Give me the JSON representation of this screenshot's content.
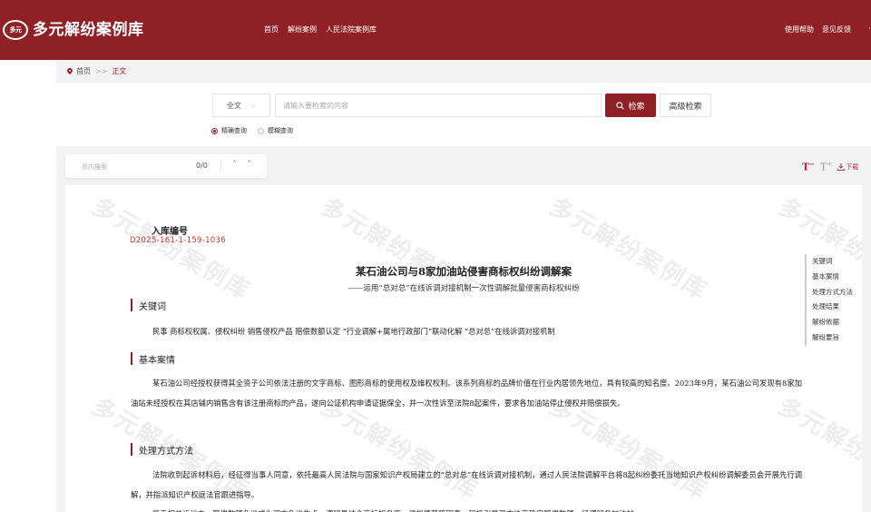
{
  "header": {
    "logo_text": "多元",
    "site_title": "多元解纷案例库",
    "nav": [
      "首页",
      "解纷案例",
      "人民法院案例库"
    ],
    "right_links": [
      "使用帮助",
      "意见反馈"
    ],
    "more": "·"
  },
  "breadcrumb": {
    "home": "首页",
    "sep": ">>",
    "current": "正文"
  },
  "search": {
    "scope": "全文",
    "placeholder": "请输入要检索的内容",
    "search_button": "检索",
    "advanced_button": "高级检索",
    "modes": [
      {
        "label": "精确查询",
        "selected": true
      },
      {
        "label": "模糊查询",
        "selected": false
      }
    ]
  },
  "find": {
    "placeholder": "页内搜索",
    "count": "0/0"
  },
  "tools": {
    "font_decrease": "T",
    "font_increase": "T",
    "download": "下载"
  },
  "document": {
    "reg_label": "入库编号",
    "reg_no": "D2025-161-1-159-1036",
    "title": "某石油公司与8家加油站侵害商标权纠纷调解案",
    "subtitle": "——运用“总对总”在线诉调对接机制一次性调解批量侵害商标权纠纷",
    "watermark": "多元解纷案例库",
    "sections": {
      "keywords_head": "关键词",
      "keywords_text": "民事  商标权权属、侵权纠纷  销售侵权产品  赔偿数额认定  “行业调解+属地行政部门”联动化解  “总对总”在线诉调对接机制",
      "facts_head": "基本案情",
      "facts_text": "某石油公司经授权获得其全资子公司依法注册的文字商标、图形商标的使用权及维权权利。该系列商标的品牌价值在行业内居领先地位，具有较高的知名度。2023年9月，某石油公司发现有8家加油站未经授权在其店铺内销售含有该注册商标的产品，遂向公证机构申请证据保全，并一次性诉至法院8起案件，要求各加油站停止侵权并赔偿损失。",
      "method_head": "处理方式方法",
      "method_text": "法院收到起诉材料后，经征得当事人同意，依托最高人民法院与国家知识产权局建立的“总对总”在线诉调对接机制，通过人民法院调解平台将8起纠纷委托当地知识产权纠纷调解委员会开展先行调解，并指派知识产权庭法官跟进指导。",
      "next_text": "鉴于相关诉讼中，赔偿数额争议成为双方争议焦点，调解员结合商标知名度、侵权情节等因素，积极引导双方协商确定赔偿数额，经调解各加油站"
    }
  },
  "outline": [
    "关键词",
    "基本案情",
    "处理方式方法",
    "处理结果",
    "解纷依据",
    "解纷要旨"
  ],
  "colors": {
    "brand": "#8f2025",
    "accent_red": "#c0392b"
  }
}
